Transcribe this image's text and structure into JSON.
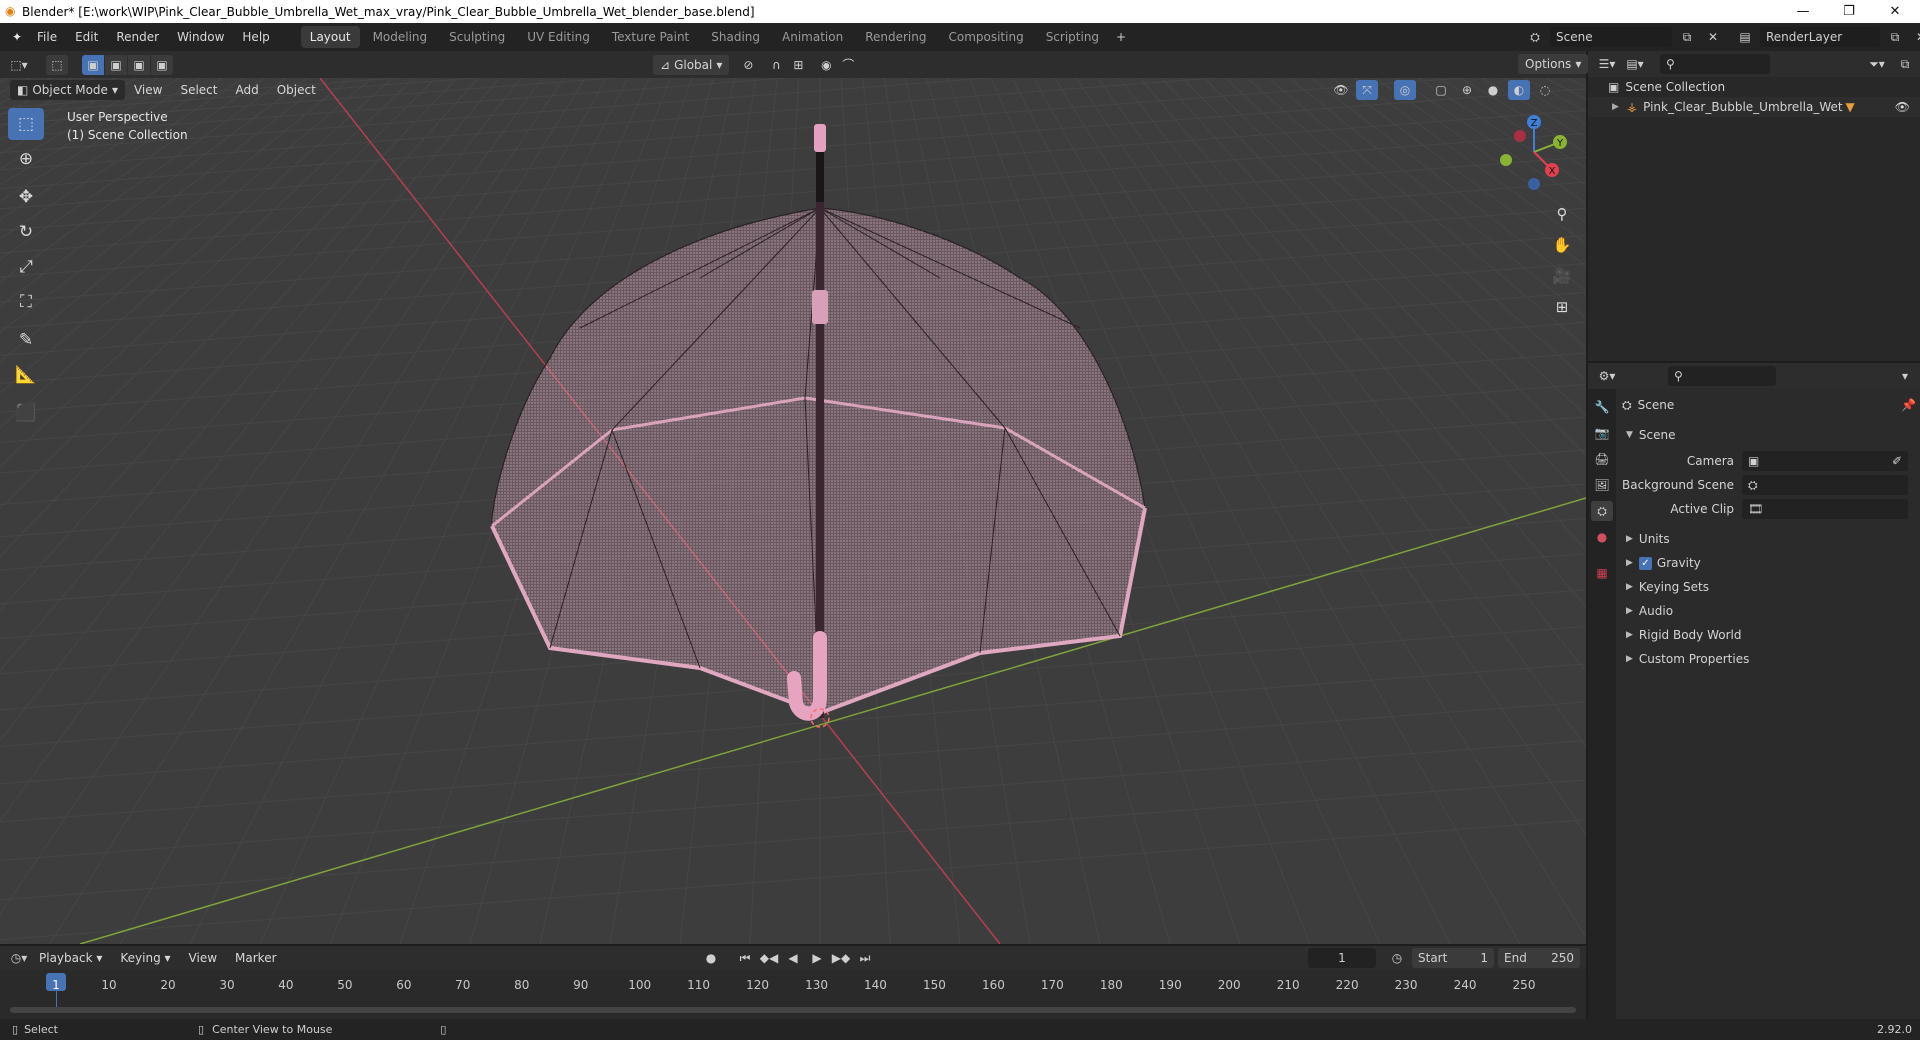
{
  "window": {
    "title": "Blender* [E:\\work\\WIP\\Pink_Clear_Bubble_Umbrella_Wet_max_vray/Pink_Clear_Bubble_Umbrella_Wet_blender_base.blend]"
  },
  "menu": [
    "File",
    "Edit",
    "Render",
    "Window",
    "Help"
  ],
  "workspaces": [
    "Layout",
    "Modeling",
    "Sculpting",
    "UV Editing",
    "Texture Paint",
    "Shading",
    "Animation",
    "Rendering",
    "Compositing",
    "Scripting"
  ],
  "active_workspace": "Layout",
  "scene": {
    "name": "Scene",
    "render_layer": "RenderLayer"
  },
  "viewport_header": {
    "mode": "Object Mode",
    "menus": [
      "View",
      "Select",
      "Add",
      "Object"
    ],
    "transform_orientation": "Global",
    "options": "Options"
  },
  "viewport": {
    "perspective": "User Perspective",
    "collection": "(1) Scene Collection"
  },
  "outliner": {
    "root": "Scene Collection",
    "items": [
      {
        "name": "Pink_Clear_Bubble_Umbrella_Wet"
      }
    ]
  },
  "properties": {
    "context": "Scene",
    "panel": "Scene",
    "fields": [
      {
        "label": "Camera"
      },
      {
        "label": "Background Scene"
      },
      {
        "label": "Active Clip"
      }
    ],
    "subpanels": [
      "Units",
      "Gravity",
      "Keying Sets",
      "Audio",
      "Rigid Body World",
      "Custom Properties"
    ],
    "gravity_checked": true
  },
  "timeline": {
    "menus": [
      "Playback",
      "Keying",
      "View",
      "Marker"
    ],
    "current_frame": "1",
    "start_label": "Start",
    "start": "1",
    "end_label": "End",
    "end": "250",
    "ticks": [
      "1",
      "10",
      "20",
      "30",
      "40",
      "50",
      "60",
      "70",
      "80",
      "90",
      "100",
      "110",
      "120",
      "130",
      "140",
      "150",
      "160",
      "170",
      "180",
      "190",
      "200",
      "210",
      "220",
      "230",
      "240",
      "250"
    ]
  },
  "status": {
    "left": "Select",
    "middle": "Center View to Mouse",
    "version": "2.92.0"
  },
  "colors": {
    "accent": "#4772b3",
    "x_axis": "#b5404d",
    "y_axis": "#7fa33a",
    "umbrella": "#e0a8c0"
  }
}
